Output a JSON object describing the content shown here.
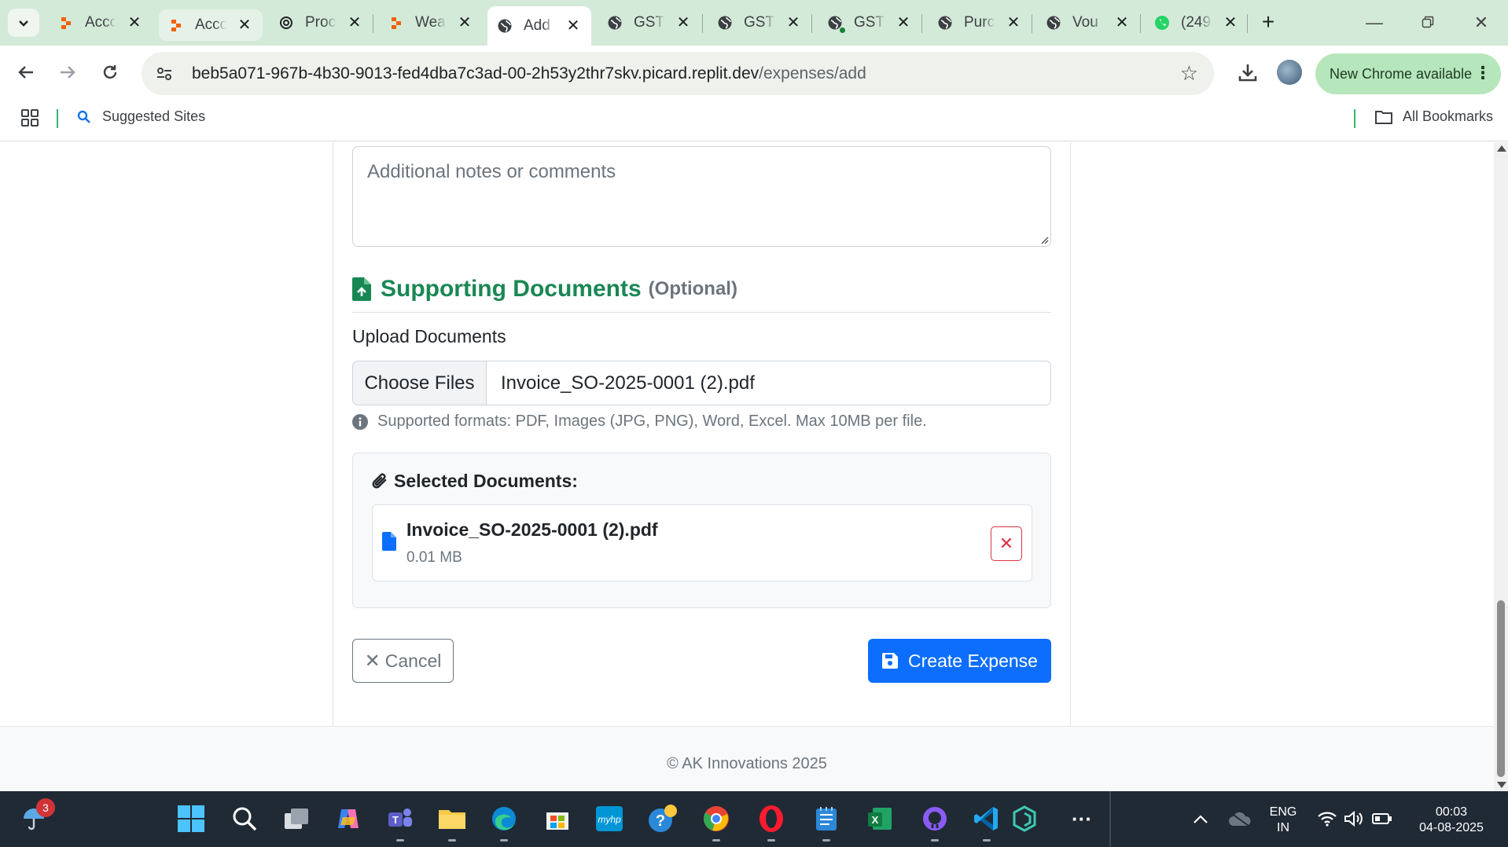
{
  "browser": {
    "tabs": [
      {
        "label": "Acco",
        "icon": "replit-icon",
        "state": "normal"
      },
      {
        "label": "Acco",
        "icon": "replit-icon",
        "state": "hovered"
      },
      {
        "label": "Proc",
        "icon": "openai-icon",
        "state": "normal"
      },
      {
        "label": "Wea",
        "icon": "replit-icon",
        "state": "normal"
      },
      {
        "label": "Add",
        "icon": "globe-icon",
        "state": "active"
      },
      {
        "label": "GST",
        "icon": "globe-icon",
        "state": "normal"
      },
      {
        "label": "GST",
        "icon": "globe-icon",
        "state": "normal"
      },
      {
        "label": "GST",
        "icon": "globe-icon",
        "state": "normal"
      },
      {
        "label": "Purc",
        "icon": "globe-icon",
        "state": "normal"
      },
      {
        "label": "Vou",
        "icon": "globe-icon",
        "state": "normal"
      },
      {
        "label": "(249",
        "icon": "whatsapp-icon",
        "state": "normal"
      }
    ],
    "url_host": "beb5a071-967b-4b30-9013-fed4dba7c3ad-00-2h53y2thr7skv.picard.replit.dev",
    "url_path": "/expenses/add",
    "update_label": "New Chrome available",
    "bookmarks": {
      "suggested": "Suggested Sites",
      "all": "All Bookmarks"
    }
  },
  "form": {
    "notes_placeholder": "Additional notes or comments",
    "section_title": "Supporting Documents",
    "section_optional": "(Optional)",
    "upload_label": "Upload Documents",
    "choose_files": "Choose Files",
    "chosen_file": "Invoice_SO-2025-0001 (2).pdf",
    "hint": "Supported formats: PDF, Images (JPG, PNG), Word, Excel. Max 10MB per file.",
    "selected_title": "Selected Documents:",
    "selected_files": [
      {
        "name": "Invoice_SO-2025-0001 (2).pdf",
        "size": "0.01 MB"
      }
    ],
    "cancel_label": "Cancel",
    "create_label": "Create Expense"
  },
  "footer": {
    "copyright": "© AK Innovations 2025"
  },
  "taskbar": {
    "weather_badge": "3",
    "lang_line1": "ENG",
    "lang_line2": "IN",
    "time": "00:03",
    "date": "04-08-2025"
  },
  "colors": {
    "success": "#198754",
    "primary": "#0d6efd",
    "danger": "#dc3545",
    "muted": "#6c757d"
  }
}
